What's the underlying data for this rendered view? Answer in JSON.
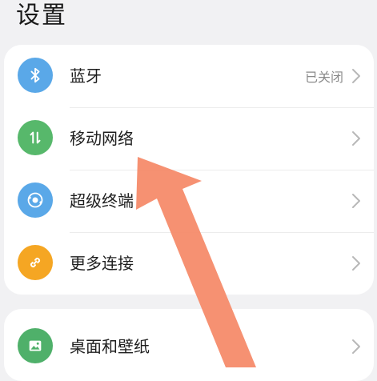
{
  "header": {
    "title": "设置"
  },
  "connections": {
    "items": [
      {
        "label": "蓝牙",
        "status": "已关闭",
        "icon": "bluetooth-icon",
        "color": "#5aa8e8"
      },
      {
        "label": "移动网络",
        "icon": "mobile-data-icon",
        "color": "#57b86b"
      },
      {
        "label": "超级终端",
        "icon": "super-device-icon",
        "color": "#5aa8e8"
      },
      {
        "label": "更多连接",
        "icon": "link-icon",
        "color": "#f5a623"
      }
    ]
  },
  "display": {
    "items": [
      {
        "label": "桌面和壁纸",
        "icon": "wallpaper-icon",
        "color": "#4fb06a"
      }
    ]
  },
  "overlay": {
    "icon": "pointer-arrow-icon",
    "color": "#f58b6a"
  }
}
